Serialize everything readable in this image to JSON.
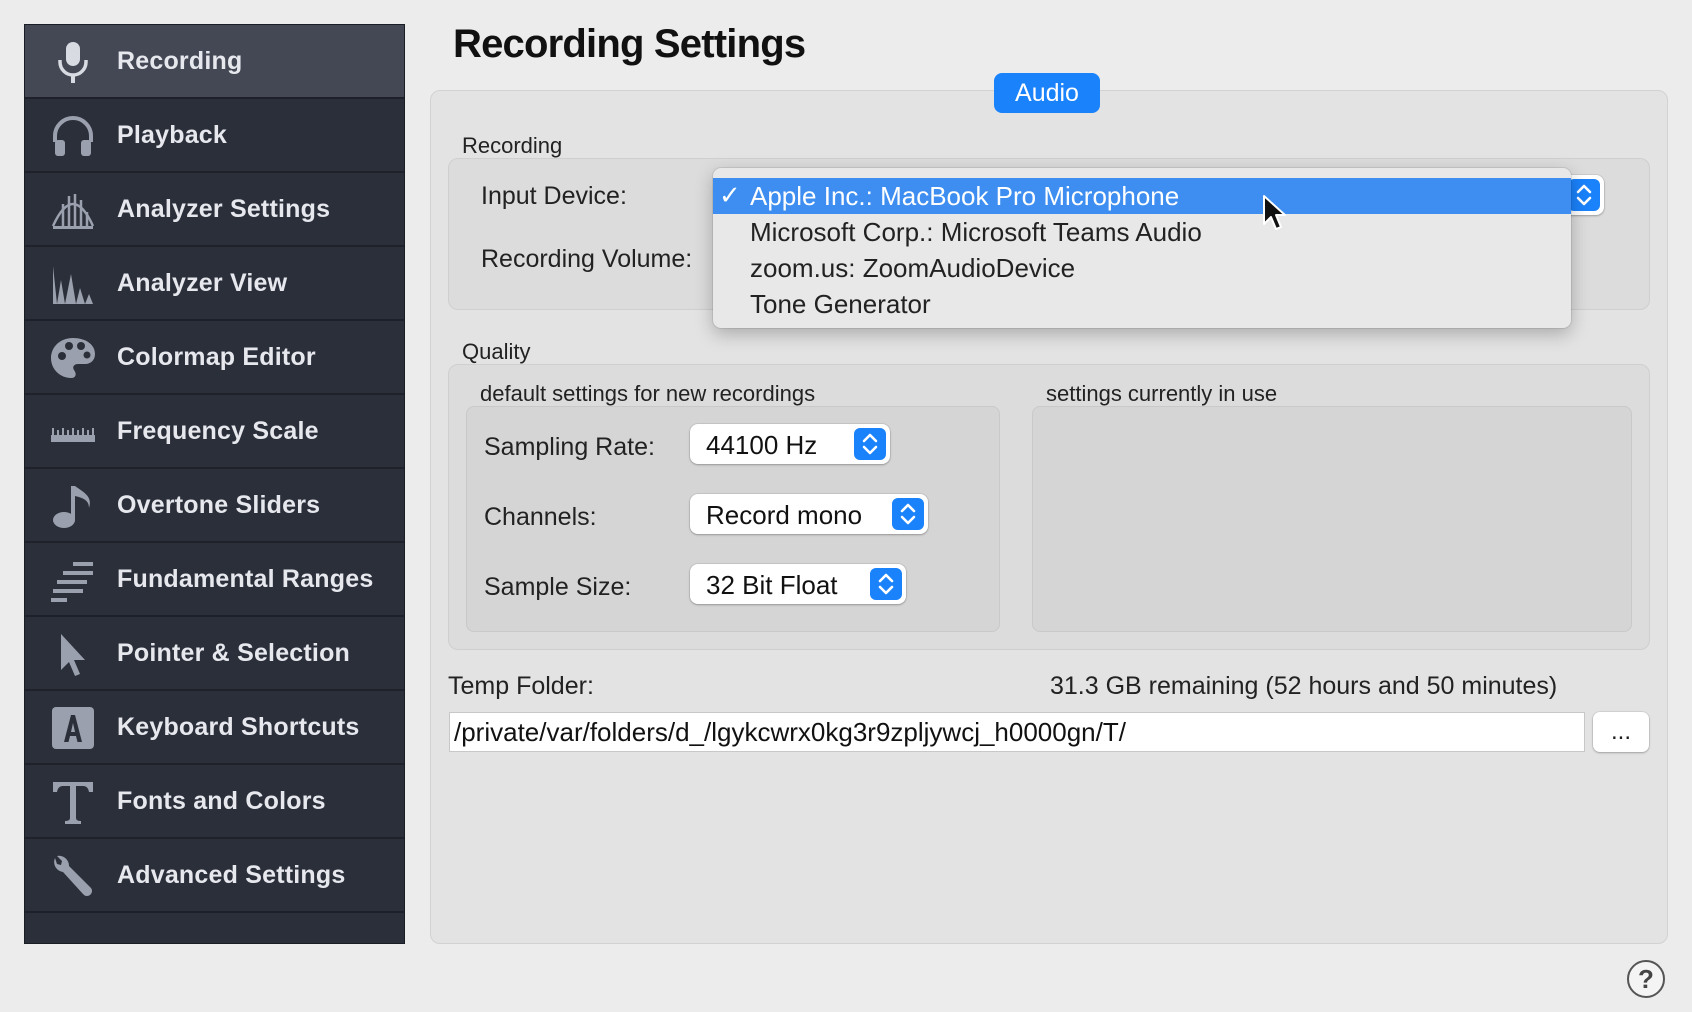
{
  "sidebar": {
    "items": [
      {
        "label": "Recording",
        "icon": "microphone-icon",
        "selected": true
      },
      {
        "label": "Playback",
        "icon": "headphones-icon"
      },
      {
        "label": "Analyzer Settings",
        "icon": "analyzer-settings-icon"
      },
      {
        "label": "Analyzer View",
        "icon": "spectrum-icon"
      },
      {
        "label": "Colormap Editor",
        "icon": "palette-icon"
      },
      {
        "label": "Frequency Scale",
        "icon": "ruler-icon"
      },
      {
        "label": "Overtone Sliders",
        "icon": "music-note-icon"
      },
      {
        "label": "Fundamental Ranges",
        "icon": "ranges-icon"
      },
      {
        "label": "Pointer & Selection",
        "icon": "pointer-icon"
      },
      {
        "label": "Keyboard Shortcuts",
        "icon": "keyboard-key-icon"
      },
      {
        "label": "Fonts and Colors",
        "icon": "font-icon"
      },
      {
        "label": "Advanced Settings",
        "icon": "wrench-icon"
      }
    ]
  },
  "page": {
    "title": "Recording Settings"
  },
  "tabs": {
    "audio": "Audio"
  },
  "recording": {
    "section_label": "Recording",
    "input_device_label": "Input Device:",
    "recording_volume_label": "Recording Volume:",
    "input_device_options": [
      {
        "label": "Apple Inc.: MacBook Pro Microphone",
        "selected": true
      },
      {
        "label": "Microsoft Corp.: Microsoft Teams Audio"
      },
      {
        "label": "zoom.us: ZoomAudioDevice"
      },
      {
        "label": "Tone Generator"
      }
    ],
    "check_mark": "✓"
  },
  "quality": {
    "section_label": "Quality",
    "defaults_label": "default settings for new recordings",
    "current_label": "settings currently in use",
    "sampling_rate_label": "Sampling Rate:",
    "sampling_rate_value": "44100 Hz",
    "channels_label": "Channels:",
    "channels_value": "Record mono",
    "sample_size_label": "Sample Size:",
    "sample_size_value": "32 Bit Float"
  },
  "temp_folder": {
    "label": "Temp Folder:",
    "remaining": "31.3 GB remaining (52 hours and 50 minutes)",
    "path": "/private/var/folders/d_/lgykcwrx0kg3r9zpljywcj_h0000gn/T/",
    "browse_label": "..."
  },
  "help": {
    "label": "?"
  },
  "colors": {
    "accent": "#1a82fb",
    "sidebar_bg": "#2b2f3a",
    "sidebar_selected": "#444854"
  }
}
